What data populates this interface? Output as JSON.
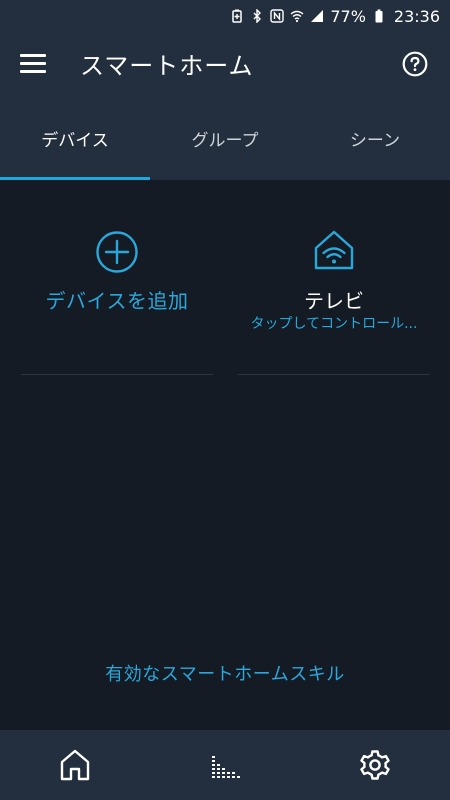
{
  "status_bar": {
    "battery": "77%",
    "time": "23:36",
    "icons": [
      "battery-saver-icon",
      "bluetooth-icon",
      "nfc-icon",
      "wifi-icon",
      "signal-icon",
      "battery-icon"
    ]
  },
  "app_bar": {
    "title": "スマートホーム",
    "menu_icon": "hamburger-menu-icon",
    "help_icon": "help-question-icon"
  },
  "tabs": [
    {
      "label": "デバイス",
      "active": true
    },
    {
      "label": "グループ",
      "active": false
    },
    {
      "label": "シーン",
      "active": false
    }
  ],
  "devices": {
    "add_device": {
      "label": "デバイスを追加",
      "icon": "add-circle-icon"
    },
    "tv": {
      "label": "テレビ",
      "subtitle": "タップしてコントロール...",
      "icon": "smart-home-wifi-icon"
    }
  },
  "skills_link": "有効なスマートホームスキル",
  "bottom_nav": {
    "items": [
      {
        "icon": "home-icon"
      },
      {
        "icon": "activity-icon"
      },
      {
        "icon": "settings-icon"
      }
    ]
  },
  "colors": {
    "accent": "#1ba8dd",
    "bar_background": "#232f3e",
    "content_background": "#151b24"
  }
}
